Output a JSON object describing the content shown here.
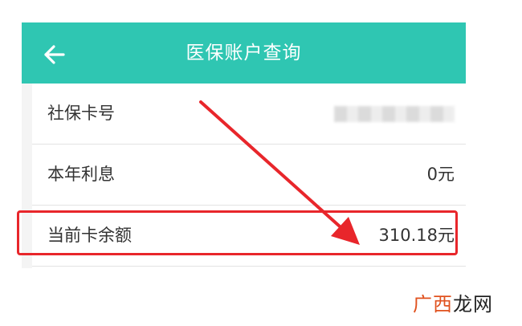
{
  "header": {
    "title": "医保账户查询",
    "back_icon": "arrow-left-icon"
  },
  "rows": [
    {
      "label": "社保卡号",
      "value": ""
    },
    {
      "label": "本年利息",
      "value": "0元"
    },
    {
      "label": "当前卡余额",
      "value": "310.18元"
    }
  ],
  "watermark": {
    "part1": "广西",
    "part2": "龙网"
  },
  "colors": {
    "header_bg": "#2fc6b2",
    "annotation_red": "#e8262b"
  }
}
